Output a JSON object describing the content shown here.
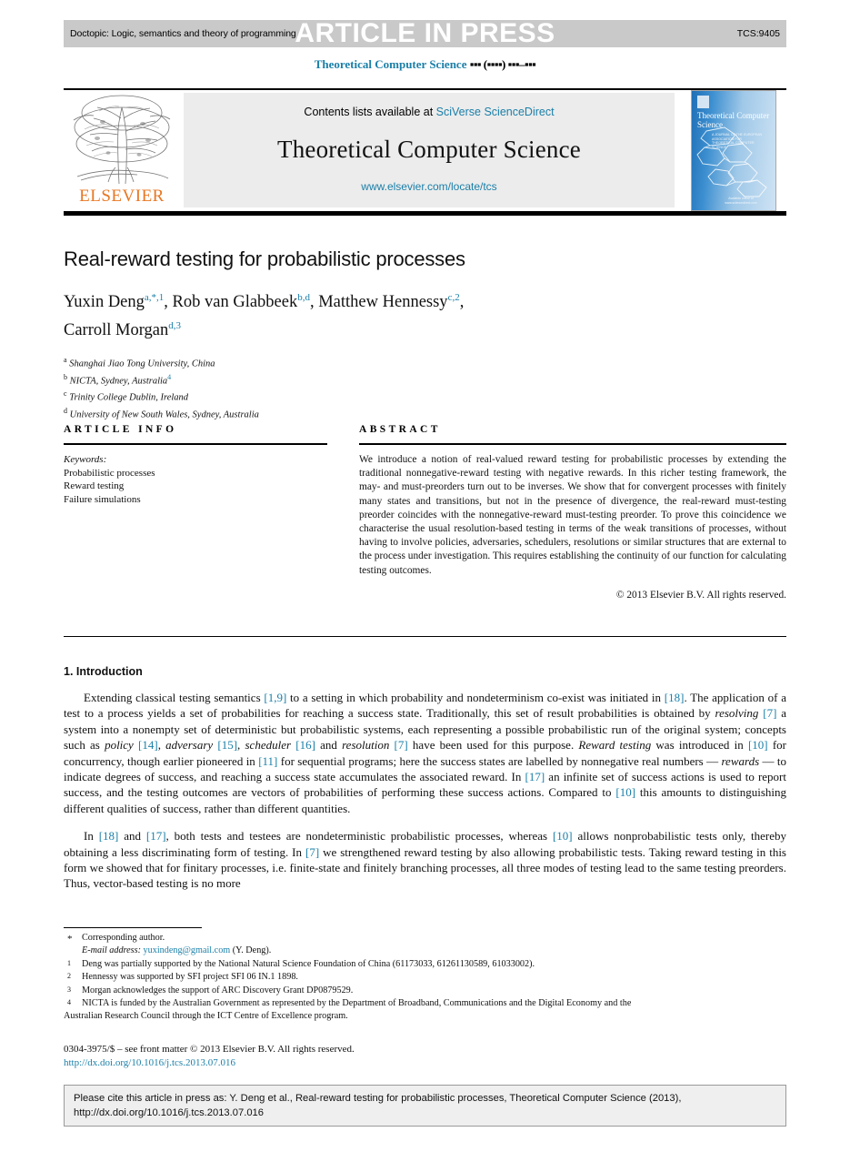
{
  "header": {
    "doctopic": "Doctopic: Logic, semantics and theory of programming",
    "article_in_press": "ARTICLE IN PRESS",
    "tcs_code": "TCS:9405",
    "running_head_journal": "Theoretical Computer Science",
    "running_head_issue": "▪▪▪ (▪▪▪▪) ▪▪▪–▪▪▪"
  },
  "masthead": {
    "contents_prefix": "Contents lists available at",
    "contents_link": "SciVerse ScienceDirect",
    "journal_name": "Theoretical Computer Science",
    "journal_url": "www.elsevier.com/locate/tcs",
    "publisher": "ELSEVIER",
    "cover_title": "Theoretical Computer Science",
    "cover_subtitle": "A JOURNAL OF THE EUROPEAN ASSOCIATION FOR THEORETICAL COMPUTER SCIENCE",
    "cover_footer": "Available online at www.sciencedirect.com"
  },
  "article": {
    "title": "Real-reward testing for probabilistic processes",
    "authors_line1_a": "Yuxin Deng",
    "authors_line1_a_sup": "a,*,1",
    "authors_line1_b": ", Rob van Glabbeek",
    "authors_line1_b_sup": "b,d",
    "authors_line1_c": ", Matthew Hennessy",
    "authors_line1_c_sup": "c,2",
    "authors_line1_tail": ",",
    "authors_line2": "Carroll Morgan",
    "authors_line2_sup": "d,3",
    "affiliations": [
      {
        "mark": "a",
        "text": "Shanghai Jiao Tong University, China",
        "note": ""
      },
      {
        "mark": "b",
        "text": "NICTA, Sydney, Australia",
        "note": "4"
      },
      {
        "mark": "c",
        "text": "Trinity College Dublin, Ireland",
        "note": ""
      },
      {
        "mark": "d",
        "text": "University of New South Wales, Sydney, Australia",
        "note": ""
      }
    ]
  },
  "article_info": {
    "heading": "ARTICLE INFO",
    "keywords_label": "Keywords:",
    "keywords": [
      "Probabilistic processes",
      "Reward testing",
      "Failure simulations"
    ]
  },
  "abstract": {
    "heading": "ABSTRACT",
    "text": "We introduce a notion of real-valued reward testing for probabilistic processes by extending the traditional nonnegative-reward testing with negative rewards. In this richer testing framework, the may- and must-preorders turn out to be inverses. We show that for convergent processes with finitely many states and transitions, but not in the presence of divergence, the real-reward must-testing preorder coincides with the nonnegative-reward must-testing preorder. To prove this coincidence we characterise the usual resolution-based testing in terms of the weak transitions of processes, without having to involve policies, adversaries, schedulers, resolutions or similar structures that are external to the process under investigation. This requires establishing the continuity of our function for calculating testing outcomes.",
    "copyright": "© 2013 Elsevier B.V. All rights reserved."
  },
  "introduction": {
    "heading": "1. Introduction",
    "p1_s1": "Extending classical testing semantics ",
    "p1_r1": "[1,9]",
    "p1_s2": " to a setting in which probability and nondeterminism co-exist was initiated in ",
    "p1_r2": "[18]",
    "p1_s3": ". The application of a test to a process yields a set of probabilities for reaching a success state. Traditionally, this set of result probabilities is obtained by ",
    "p1_i1": "resolving",
    "p1_s4": " ",
    "p1_r3": "[7]",
    "p1_s5": " a system into a nonempty set of deterministic but probabilistic systems, each representing a possible probabilistic run of the original system; concepts such as ",
    "p1_i2": "policy",
    "p1_s6": " ",
    "p1_r4": "[14]",
    "p1_s7": ", ",
    "p1_i3": "adversary",
    "p1_s8": " ",
    "p1_r5": "[15]",
    "p1_s9": ", ",
    "p1_i4": "scheduler",
    "p1_s10": " ",
    "p1_r6": "[16]",
    "p1_s11": " and ",
    "p1_i5": "resolution",
    "p1_s12": " ",
    "p1_r7": "[7]",
    "p1_s13": " have been used for this purpose. ",
    "p1_i6": "Reward testing",
    "p1_s14": " was introduced in ",
    "p1_r8": "[10]",
    "p1_s15": " for concurrency, though earlier pioneered in ",
    "p1_r9": "[11]",
    "p1_s16": " for sequential programs; here the success states are labelled by nonnegative real numbers — ",
    "p1_i7": "rewards",
    "p1_s17": " — to indicate degrees of success, and reaching a success state accumulates the associated reward. In ",
    "p1_r10": "[17]",
    "p1_s18": " an infinite set of success actions is used to report success, and the testing outcomes are vectors of probabilities of performing these success actions. Compared to ",
    "p1_r11": "[10]",
    "p1_s19": " this amounts to distinguishing different qualities of success, rather than different quantities.",
    "p2_s1": "In ",
    "p2_r1": "[18]",
    "p2_s2": " and ",
    "p2_r2": "[17]",
    "p2_s3": ", both tests and testees are nondeterministic probabilistic processes, whereas ",
    "p2_r3": "[10]",
    "p2_s4": " allows nonprobabilistic tests only, thereby obtaining a less discriminating form of testing. In ",
    "p2_r4": "[7]",
    "p2_s5": " we strengthened reward testing by also allowing probabilistic tests. Taking reward testing in this form we showed that for finitary processes, i.e. finite-state and finitely branching processes, all three modes of testing lead to the same testing preorders. Thus, vector-based testing is no more"
  },
  "footnotes": {
    "corresponding": "Corresponding author.",
    "email_label": "E-mail address:",
    "email": "yuxindeng@gmail.com",
    "email_suffix": "(Y. Deng).",
    "note1": "Deng was partially supported by the National Natural Science Foundation of China (61173033, 61261130589, 61033002).",
    "note2": "Hennessy was supported by SFI project SFI 06 IN.1 1898.",
    "note3": "Morgan acknowledges the support of ARC Discovery Grant DP0879529.",
    "note4": "NICTA is funded by the Australian Government as represented by the Department of Broadband, Communications and the Digital Economy and the",
    "note4_cont": "Australian Research Council through the ICT Centre of Excellence program.",
    "marks": {
      "star": "*",
      "n1": "1",
      "n2": "2",
      "n3": "3",
      "n4": "4"
    }
  },
  "frontmatter": {
    "line1": "0304-3975/$ – see front matter © 2013 Elsevier B.V. All rights reserved.",
    "doi": "http://dx.doi.org/10.1016/j.tcs.2013.07.016"
  },
  "cite_box": {
    "line1": "Please cite this article in press as: Y. Deng et al., Real-reward testing for probabilistic processes, Theoretical Computer Science (2013),",
    "line2": "http://dx.doi.org/10.1016/j.tcs.2013.07.016"
  },
  "colors": {
    "link": "#1a7fa8",
    "elsevier_orange": "#e87722",
    "press_bar": "#c9c9c9",
    "panel_gray": "#ececec"
  }
}
